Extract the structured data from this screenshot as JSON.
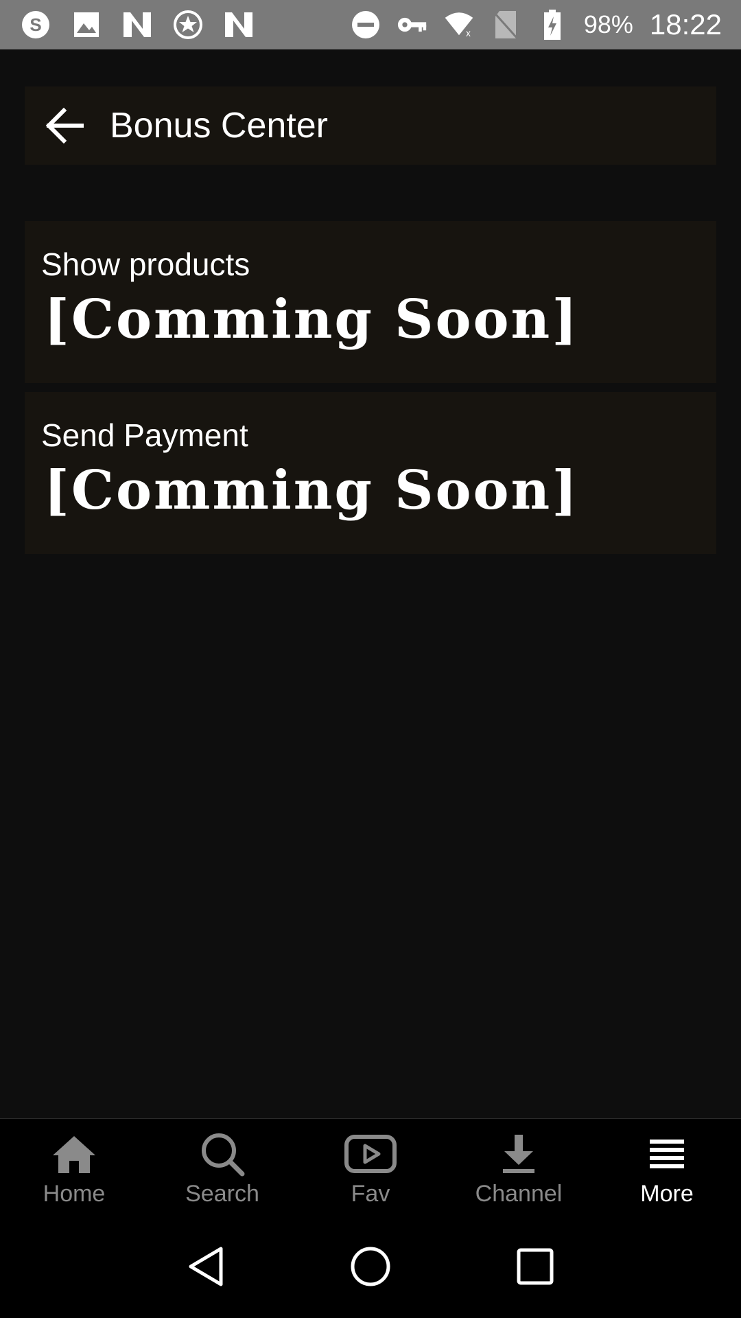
{
  "status_bar": {
    "left_icons": [
      "skype-icon",
      "image-icon",
      "n-app-icon",
      "star-badge-icon",
      "n-app-icon"
    ],
    "right_icons": [
      "do-not-disturb-icon",
      "vpn-key-icon",
      "wifi-off-icon",
      "no-sim-icon",
      "battery-charging-icon"
    ],
    "battery": "98%",
    "time": "18:22"
  },
  "header": {
    "title": "Bonus Center"
  },
  "cards": [
    {
      "label": "Show products",
      "value": "[Comming Soon]"
    },
    {
      "label": "Send Payment",
      "value": "[Comming Soon]"
    }
  ],
  "tabs": [
    {
      "label": "Home",
      "icon": "home-icon",
      "active": false
    },
    {
      "label": "Search",
      "icon": "search-icon",
      "active": false
    },
    {
      "label": "Fav",
      "icon": "play-icon",
      "active": false
    },
    {
      "label": "Channel",
      "icon": "download-icon",
      "active": false
    },
    {
      "label": "More",
      "icon": "menu-icon",
      "active": true
    }
  ],
  "colors": {
    "background": "#0e0e0e",
    "card": "#17140f",
    "status_bar": "#7a7a7a",
    "tab_inactive": "#8a8a8a",
    "tab_active": "#ffffff"
  }
}
